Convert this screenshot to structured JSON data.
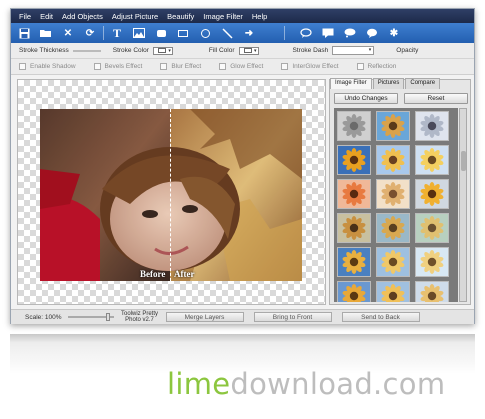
{
  "menu": [
    "File",
    "Edit",
    "Add Objects",
    "Adjust Picture",
    "Beautify",
    "Image Filter",
    "Help"
  ],
  "toolbar": {
    "icons": [
      "save-icon",
      "open-folder-icon",
      "close-icon",
      "refresh-icon",
      "text-icon",
      "image-icon",
      "rounded-rect-icon",
      "rectangle-icon",
      "circle-icon",
      "line-icon",
      "arrow-icon",
      "speech-bubble-icon",
      "callout-rect-icon",
      "cloud-callout-icon",
      "heart-callout-icon",
      "puzzle-icon"
    ]
  },
  "properties": {
    "stroke_thickness": "Stroke Thickness",
    "stroke_color": "Stroke Color",
    "fill_color": "Fill Color",
    "stroke_dash": "Stroke Dash",
    "opacity": "Opacity"
  },
  "effects": [
    "Enable Shadow",
    "Bevels Effect",
    "Blur Effect",
    "Glow Effect",
    "InterGlow Effect",
    "Reflection"
  ],
  "canvas": {
    "before_label": "Before",
    "after_label": "After"
  },
  "panel": {
    "tabs": [
      "Image Filter",
      "Pictures",
      "Compare"
    ],
    "undo_changes": "Undo Changes",
    "reset": "Reset"
  },
  "status": {
    "scale": "Scale: 100%",
    "brand_line1": "Toolwiz Pretty",
    "brand_line2": "Photo v2.7",
    "merge_layers": "Merge Layers",
    "bring_to_front": "Bring to Front",
    "send_to_back": "Send to Back"
  },
  "watermark": {
    "part1": "lime",
    "part2": "download.com"
  }
}
